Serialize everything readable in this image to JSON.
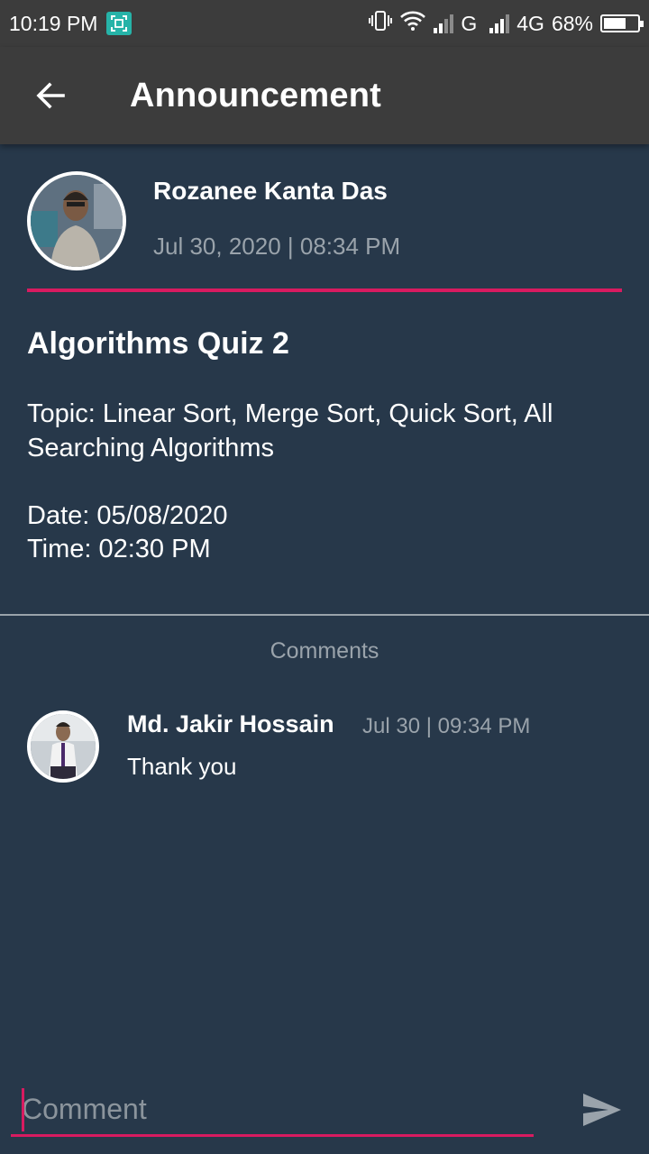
{
  "status_bar": {
    "time": "10:19 PM",
    "network_1": "G",
    "network_2": "4G",
    "battery_percent": "68%",
    "battery_level": 0.68,
    "icons": [
      "screenshot-icon",
      "vibrate-icon",
      "wifi-icon",
      "signal-icon",
      "signal-icon",
      "battery-icon"
    ]
  },
  "app_bar": {
    "title": "Announcement",
    "back_icon": "arrow-left-icon"
  },
  "post": {
    "author_name": "Rozanee Kanta Das",
    "date": "Jul 30, 2020 | 08:34 PM",
    "title": "Algorithms Quiz 2",
    "body": "Topic: Linear Sort, Merge Sort, Quick Sort, All Searching Algorithms\n\nDate: 05/08/2020\nTime: 02:30 PM"
  },
  "comments": {
    "heading": "Comments",
    "items": [
      {
        "author": "Md. Jakir Hossain",
        "time": "Jul 30 | 09:34 PM",
        "text": "Thank you"
      }
    ]
  },
  "comment_input": {
    "placeholder": "Comment",
    "value": "",
    "send_icon": "send-icon"
  },
  "colors": {
    "background": "#27384a",
    "app_bar": "#3c3c3c",
    "accent": "#d81b60",
    "muted_text": "#9aa3ab"
  }
}
